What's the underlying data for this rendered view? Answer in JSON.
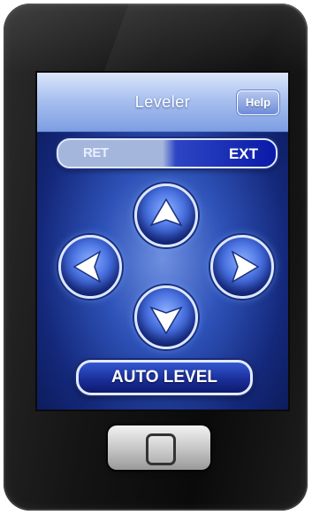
{
  "app": {
    "title": "Leveler",
    "help_label": "Help"
  },
  "toggle": {
    "left_label": "RET",
    "right_label": "EXT",
    "selected": "EXT"
  },
  "controls": {
    "up_icon": "arrow-up-icon",
    "left_icon": "arrow-left-icon",
    "right_icon": "arrow-right-icon",
    "down_icon": "arrow-down-icon",
    "auto_level_label": "AUTO LEVEL"
  },
  "device": {
    "home_icon": "home-button-icon"
  },
  "colors": {
    "titlebar": "#aac1ef",
    "screen_bg": "#2e52b8",
    "accent": "#0a1aa8",
    "device_body": "#141414"
  }
}
